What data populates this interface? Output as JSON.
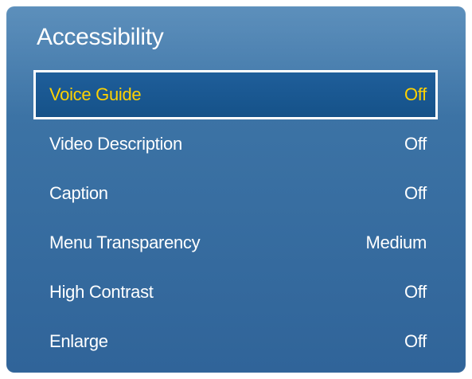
{
  "panel": {
    "title": "Accessibility"
  },
  "menu": {
    "items": [
      {
        "label": "Voice Guide",
        "value": "Off"
      },
      {
        "label": "Video Description",
        "value": "Off"
      },
      {
        "label": "Caption",
        "value": "Off"
      },
      {
        "label": "Menu Transparency",
        "value": "Medium"
      },
      {
        "label": "High Contrast",
        "value": "Off"
      },
      {
        "label": "Enlarge",
        "value": "Off"
      }
    ]
  },
  "colors": {
    "panel_top": "#4f86b6",
    "panel_bottom": "#306499",
    "selected_text": "#ffd200",
    "text": "#ffffff"
  }
}
